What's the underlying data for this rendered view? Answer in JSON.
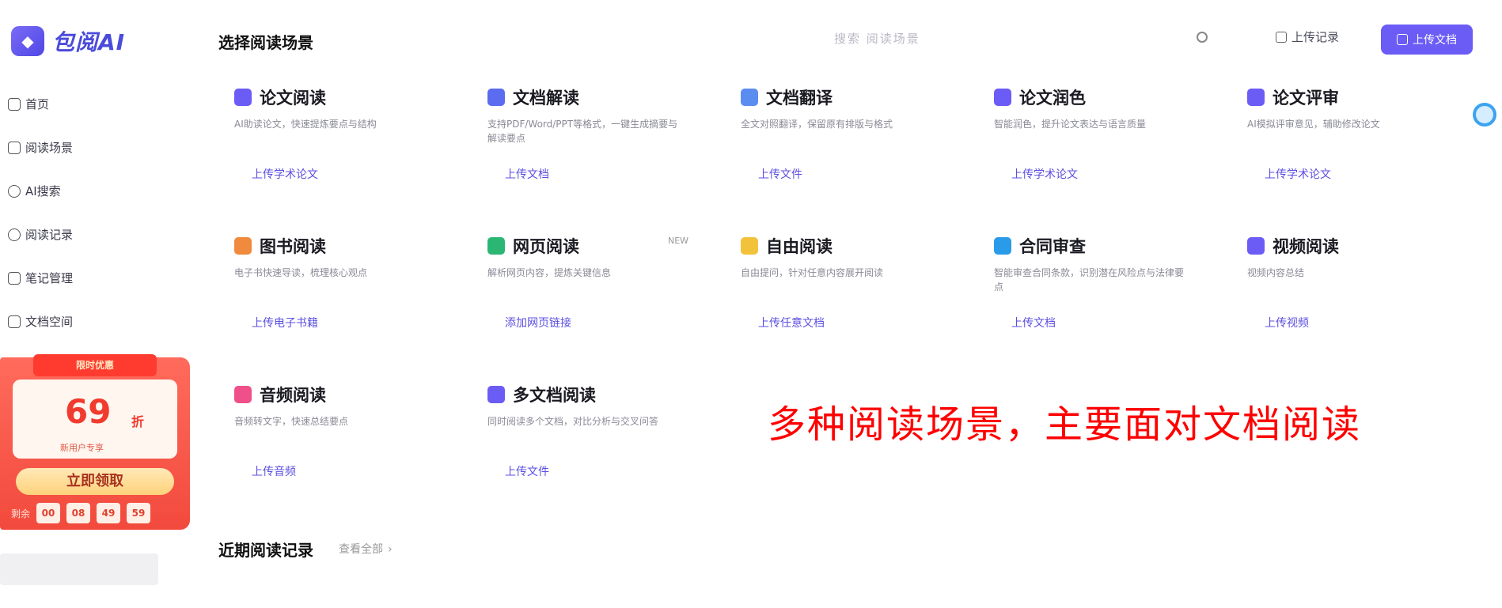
{
  "app": {
    "logo_text": "包阅AI"
  },
  "sidebar": {
    "items": [
      {
        "label": "首页",
        "icon": "home-icon"
      },
      {
        "label": "阅读场景",
        "icon": "scene-icon"
      },
      {
        "label": "AI搜索",
        "icon": "ai-search-icon"
      },
      {
        "label": "阅读记录",
        "icon": "clock-icon"
      },
      {
        "label": "笔记管理",
        "icon": "notes-icon"
      },
      {
        "label": "文档空间",
        "icon": "folder-icon"
      }
    ],
    "promo": {
      "tag": "限时优惠",
      "number": "69",
      "unit": "折",
      "subtitle": "新用户专享",
      "button": "立即领取",
      "timer_label": "剩余",
      "timer": [
        "00",
        "08",
        "49",
        "59"
      ]
    }
  },
  "header": {
    "title": "选择阅读场景",
    "search_hint": "搜索 阅读场景",
    "history_label": "上传记录",
    "upload_label": "上传文档"
  },
  "scenes": [
    {
      "title": "论文阅读",
      "desc": "AI助读论文，快速提炼要点与结构",
      "link": "上传学术论文",
      "color": "#6b5cf6"
    },
    {
      "title": "文档解读",
      "desc": "支持PDF/Word/PPT等格式，一键生成摘要与解读要点",
      "link": "上传文档",
      "color": "#5b6cf0"
    },
    {
      "title": "文档翻译",
      "desc": "全文对照翻译，保留原有排版与格式",
      "link": "上传文件",
      "color": "#5b8cf0"
    },
    {
      "title": "论文润色",
      "desc": "智能润色，提升论文表达与语言质量",
      "link": "上传学术论文",
      "color": "#6b5cf6"
    },
    {
      "title": "论文评审",
      "desc": "AI模拟评审意见，辅助修改论文",
      "link": "上传学术论文",
      "color": "#6b5cf6"
    },
    {
      "title": "图书阅读",
      "desc": "电子书快速导读，梳理核心观点",
      "link": "上传电子书籍",
      "color": "#f08a3c"
    },
    {
      "title": "网页阅读",
      "desc": "解析网页内容，提炼关键信息",
      "link": "添加网页链接",
      "color": "#2bb673",
      "badge": "NEW"
    },
    {
      "title": "自由阅读",
      "desc": "自由提问，针对任意内容展开阅读",
      "link": "上传任意文档",
      "color": "#f2c23a"
    },
    {
      "title": "合同审查",
      "desc": "智能审查合同条款，识别潜在风险点与法律要点",
      "link": "上传文档",
      "color": "#2a9be8"
    },
    {
      "title": "视频阅读",
      "desc": "视频内容总结",
      "link": "上传视频",
      "color": "#6b5cf6"
    },
    {
      "title": "音频阅读",
      "desc": "音频转文字，快速总结要点",
      "link": "上传音频",
      "color": "#f0508a"
    },
    {
      "title": "多文档阅读",
      "desc": "同时阅读多个文档，对比分析与交叉问答",
      "link": "上传文件",
      "color": "#6b5cf6"
    }
  ],
  "annotation": "多种阅读场景，主要面对文档阅读",
  "recent": {
    "title": "近期阅读记录",
    "more": "查看全部"
  }
}
